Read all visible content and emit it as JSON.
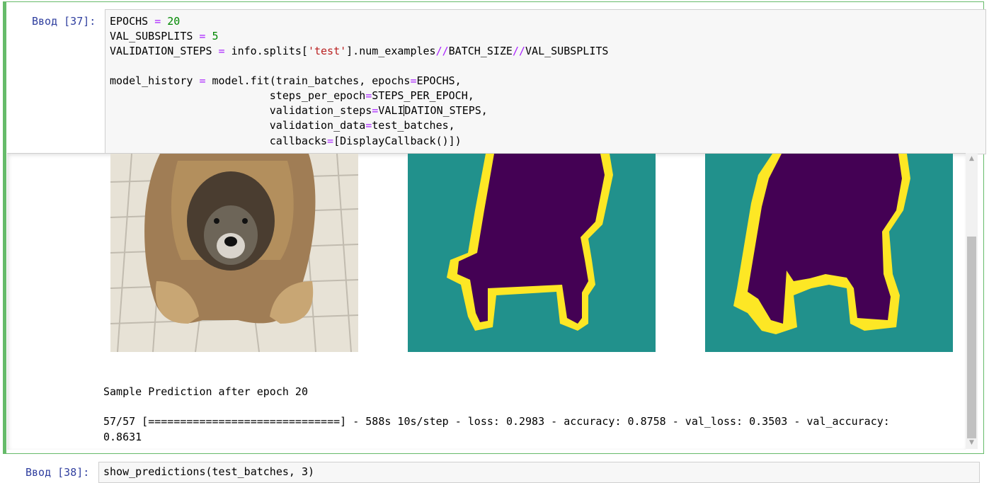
{
  "cell": {
    "prompt": "Ввод [37]:",
    "code": {
      "line1": {
        "name": "EPOCHS",
        "op": " = ",
        "value": "20"
      },
      "line2": {
        "name": "VAL_SUBSPLITS",
        "op": " = ",
        "value": "5"
      },
      "line3": {
        "pre": "VALIDATION_STEPS ",
        "eq": "=",
        "mid": " info.splits[",
        "str": "'test'",
        "post": "].num_examples",
        "div1": "//",
        "bs": "BATCH_SIZE",
        "div2": "//",
        "vs": "VAL_SUBSPLITS"
      },
      "line5": {
        "pre": "model_history ",
        "eq": "=",
        "mid": " model.fit(train_batches, epochs",
        "eq2": "=",
        "post": "EPOCHS,"
      },
      "line6": {
        "pre": "                         steps_per_epoch",
        "eq": "=",
        "post": "STEPS_PER_EPOCH,"
      },
      "line7": {
        "pre": "                         validation_steps",
        "eq": "=",
        "post_a": "VALI",
        "post_b": "DATION_STEPS,"
      },
      "line8": {
        "pre": "                         validation_data",
        "eq": "=",
        "post": "test_batches,"
      },
      "line9": {
        "pre": "                         callbacks",
        "eq": "=",
        "post": "[DisplayCallback()])"
      }
    }
  },
  "output": {
    "images": [
      "Input Image",
      "True Mask",
      "Predicted Mask"
    ],
    "sample_text": "Sample Prediction after epoch 20",
    "progress_line": "57/57 [==============================] - 588s 10s/step - loss: 0.2983 - accuracy: 0.8758 - val_loss: 0.3503 - val_accuracy:",
    "progress_line2": "0.8631",
    "colors": {
      "mask_bg": "#21918c",
      "mask_fg": "#440154",
      "mask_border": "#fde725"
    }
  },
  "next_cell": {
    "prompt": "Ввод [38]:",
    "code": "show_predictions(test_batches, 3)"
  }
}
